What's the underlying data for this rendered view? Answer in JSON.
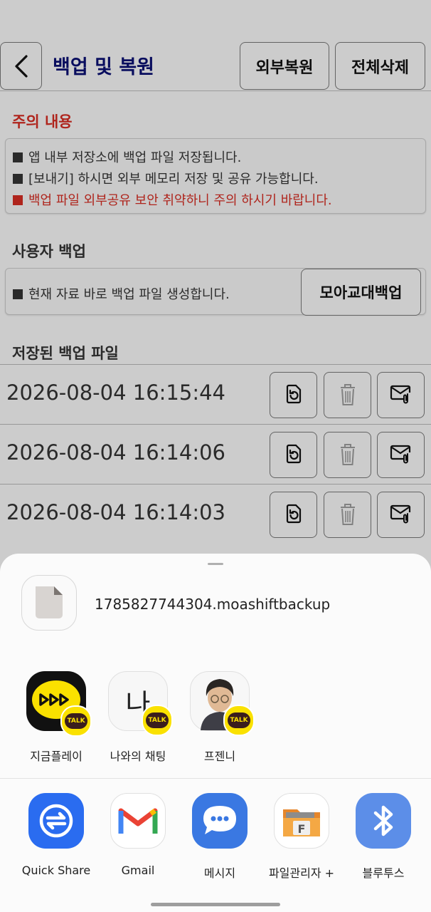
{
  "header": {
    "title": "백업 및 복원",
    "btn_external_restore": "외부복원",
    "btn_delete_all": "전체삭제"
  },
  "notice": {
    "title": "주의 내용",
    "lines": [
      "앱 내부 저장소에 백업 파일 저장됩니다.",
      "[보내기] 하시면 외부 메모리 저장 및 공유 가능합니다.",
      "백업 파일 외부공유 보안 취약하니 주의 하시기 바랍니다."
    ]
  },
  "user_backup": {
    "title": "사용자 백업",
    "text": "현재 자료 바로 백업 파일 생성합니다.",
    "button": "모아교대백업"
  },
  "saved": {
    "title": "저장된 백업 파일",
    "files": [
      "2026-08-04 16:15:44",
      "2026-08-04 16:14:06",
      "2026-08-04 16:14:03"
    ]
  },
  "share_sheet": {
    "filename": "1785827744304.moashiftbackup",
    "contacts": [
      {
        "label": "지금플레이",
        "badge": "TALK"
      },
      {
        "label": "나와의 채팅",
        "badge": "TALK",
        "glyph": "나"
      },
      {
        "label": "프젠니",
        "badge": "TALK"
      }
    ],
    "apps": [
      {
        "label": "Quick Share"
      },
      {
        "label": "Gmail"
      },
      {
        "label": "메시지"
      },
      {
        "label": "파일관리자 +",
        "glyph": "F"
      },
      {
        "label": "블루투스"
      }
    ]
  },
  "colors": {
    "title_navy": "#0b1070",
    "warning_red": "#d12c22",
    "kakao_yellow": "#fae100"
  }
}
